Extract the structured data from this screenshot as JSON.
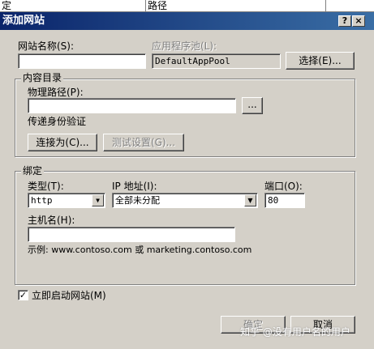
{
  "background_window": {
    "col1": "定",
    "col2": "路径"
  },
  "dialog": {
    "title": "添加网站",
    "help_label": "?",
    "close_label": "×"
  },
  "site_name": {
    "label": "网站名称(S):",
    "value": ""
  },
  "app_pool": {
    "label": "应用程序池(L):",
    "value": "DefaultAppPool",
    "select_button": "选择(E)..."
  },
  "content_dir": {
    "group_title": "内容目录",
    "path_label": "物理路径(P):",
    "path_value": "",
    "browse_button": "...",
    "auth_label": "传递身份验证",
    "connect_as_button": "连接为(C)...",
    "test_settings_button": "测试设置(G)..."
  },
  "binding": {
    "group_title": "绑定",
    "type_label": "类型(T):",
    "type_value": "http",
    "ip_label": "IP 地址(I):",
    "ip_value": "全部未分配",
    "port_label": "端口(O):",
    "port_value": "80",
    "host_label": "主机名(H):",
    "host_value": "",
    "example_text": "示例: www.contoso.com 或 marketing.contoso.com"
  },
  "start_now": {
    "label": "立即启动网站(M)",
    "checked": true,
    "check_glyph": "✓"
  },
  "footer": {
    "ok_button": "确定",
    "cancel_button": "取消"
  },
  "watermark": "知乎 @没有用户名的用户",
  "icons": {
    "dropdown": "▼"
  }
}
